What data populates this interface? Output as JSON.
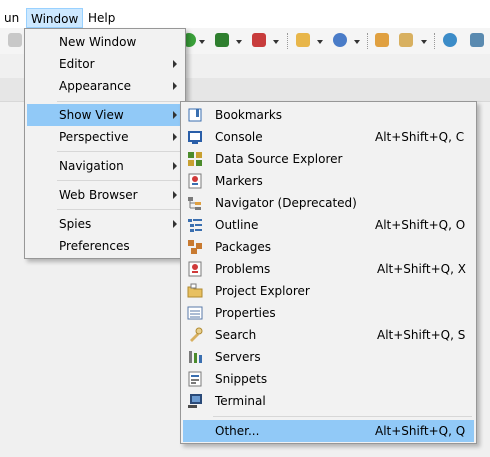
{
  "menubar": {
    "items": [
      {
        "label": "un"
      },
      {
        "label": "Window"
      },
      {
        "label": "Help"
      }
    ]
  },
  "window_menu": {
    "items": [
      {
        "label": "New Window"
      },
      {
        "label": "Editor"
      },
      {
        "label": "Appearance"
      },
      {
        "label": "Show View"
      },
      {
        "label": "Perspective"
      },
      {
        "label": "Navigation"
      },
      {
        "label": "Web Browser"
      },
      {
        "label": "Spies"
      },
      {
        "label": "Preferences"
      }
    ]
  },
  "show_view_menu": {
    "items": [
      {
        "label": "Bookmarks",
        "shortcut": "",
        "icon": "bookmarks-icon"
      },
      {
        "label": "Console",
        "shortcut": "Alt+Shift+Q, C",
        "icon": "console-icon"
      },
      {
        "label": "Data Source Explorer",
        "shortcut": "",
        "icon": "data-source-explorer-icon"
      },
      {
        "label": "Markers",
        "shortcut": "",
        "icon": "markers-icon"
      },
      {
        "label": "Navigator (Deprecated)",
        "shortcut": "",
        "icon": "navigator-icon"
      },
      {
        "label": "Outline",
        "shortcut": "Alt+Shift+Q, O",
        "icon": "outline-icon"
      },
      {
        "label": "Packages",
        "shortcut": "",
        "icon": "packages-icon"
      },
      {
        "label": "Problems",
        "shortcut": "Alt+Shift+Q, X",
        "icon": "problems-icon"
      },
      {
        "label": "Project Explorer",
        "shortcut": "",
        "icon": "project-explorer-icon"
      },
      {
        "label": "Properties",
        "shortcut": "",
        "icon": "properties-icon"
      },
      {
        "label": "Search",
        "shortcut": "Alt+Shift+Q, S",
        "icon": "search-icon"
      },
      {
        "label": "Servers",
        "shortcut": "",
        "icon": "servers-icon"
      },
      {
        "label": "Snippets",
        "shortcut": "",
        "icon": "snippets-icon"
      },
      {
        "label": "Terminal",
        "shortcut": "",
        "icon": "terminal-icon"
      },
      {
        "label": "Other...",
        "shortcut": "Alt+Shift+Q, Q",
        "icon": ""
      }
    ]
  },
  "colors": {
    "highlight": "#91c9f7",
    "menu_bg": "#f2f2f2",
    "menubar_active": "#cce8ff"
  }
}
